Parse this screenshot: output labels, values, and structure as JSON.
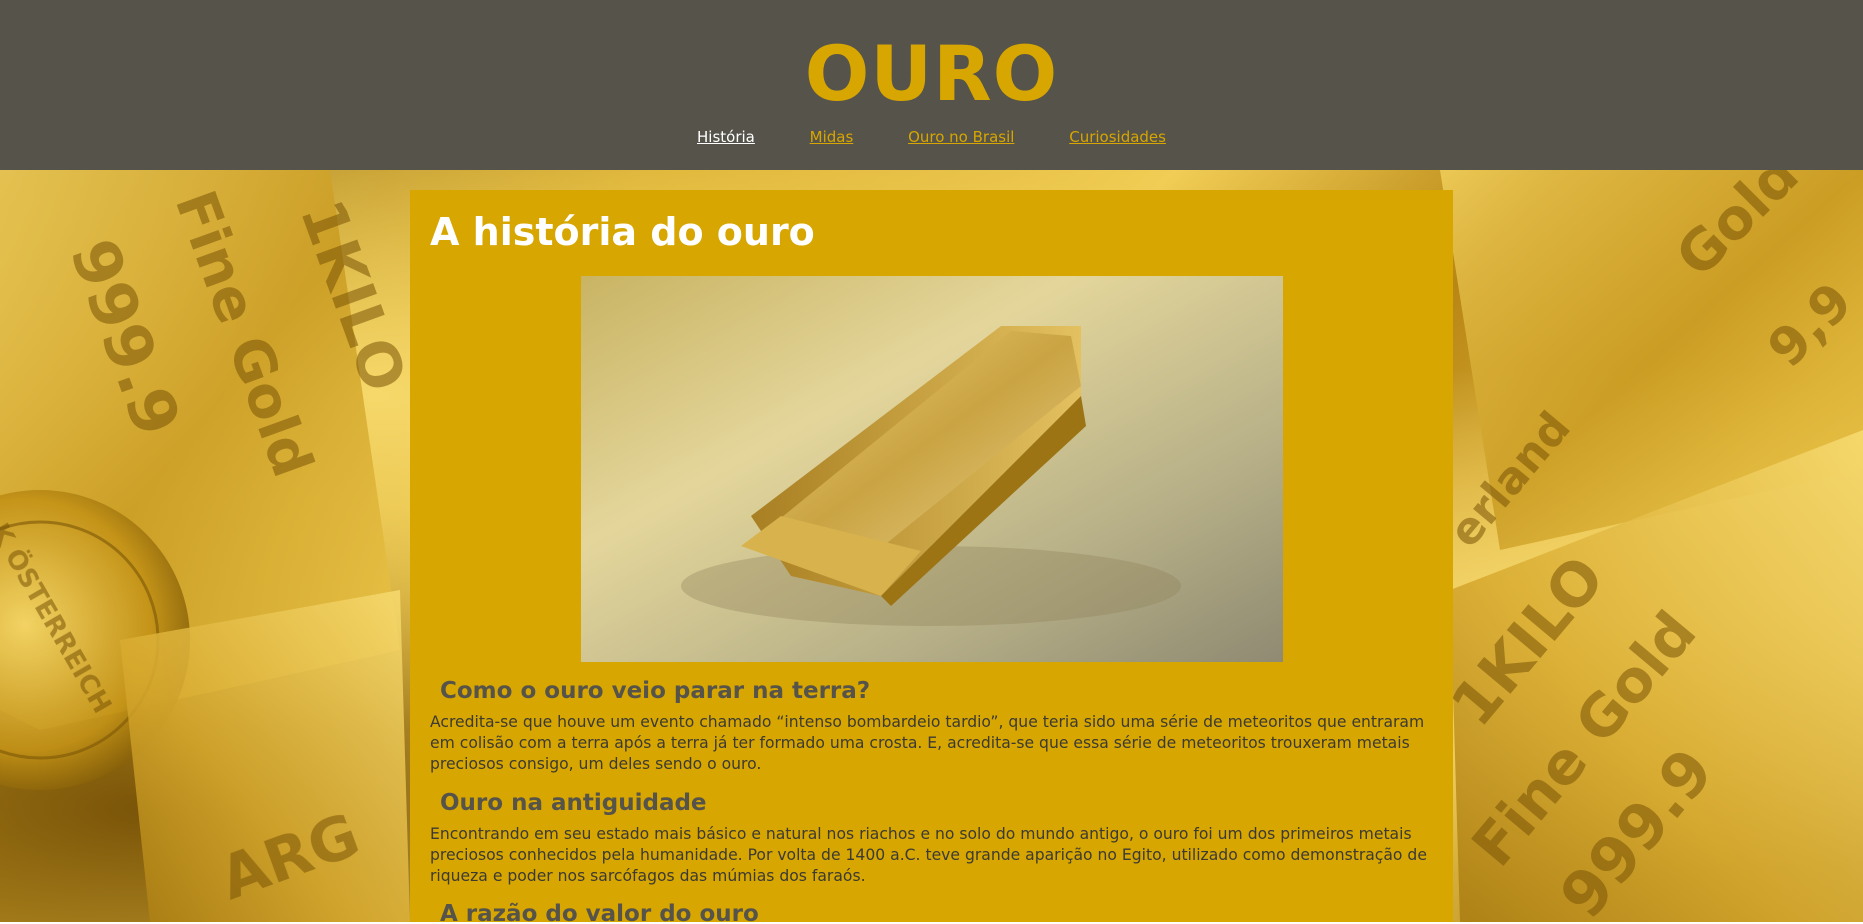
{
  "site": {
    "title": "OURO"
  },
  "nav": {
    "items": [
      {
        "label": "História",
        "active": true
      },
      {
        "label": "Midas",
        "active": false
      },
      {
        "label": "Ouro no Brasil",
        "active": false
      },
      {
        "label": "Curiosidades",
        "active": false
      }
    ]
  },
  "background": {
    "bar_inscriptions": {
      "left_top": [
        "1KILO",
        "Fine Gold",
        "999.9"
      ],
      "coin": "K ÖSTERREICH",
      "bottom": "ARG",
      "right": [
        "Gold",
        "9,9"
      ],
      "right_partial": "erland",
      "right_bottom": [
        "1KILO",
        "Fine Gold",
        "999.9"
      ]
    }
  },
  "article": {
    "title": "A história do ouro",
    "sections": [
      {
        "heading": "Como o ouro veio parar na terra?",
        "body": "Acredita-se que houve um evento chamado “intenso bombardeio tardio”, que teria sido uma série de meteoritos que entraram em colisão com a terra após a terra já ter formado uma crosta. E, acredita-se que essa série de meteoritos trouxeram metais preciosos consigo, um deles sendo o ouro."
      },
      {
        "heading": "Ouro na antiguidade",
        "body": "Encontrando em seu estado mais básico e natural nos riachos e no solo do mundo antigo, o ouro foi um dos primeiros metais preciosos conhecidos pela humanidade. Por volta de 1400 a.C. teve grande aparição no Egito, utilizado como demonstração de riqueza e poder nos sarcófagos das múmias dos faraós."
      },
      {
        "heading": "A razão do valor do ouro",
        "body": ""
      }
    ]
  },
  "colors": {
    "header_bg": "#56534a",
    "accent_gold": "#d7a600",
    "article_bg": "#d7a600",
    "heading_gray": "#56534a",
    "nav_active": "#ffffff"
  }
}
